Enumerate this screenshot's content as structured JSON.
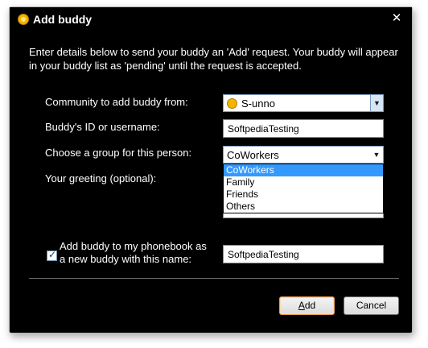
{
  "dialog": {
    "title": "Add buddy",
    "close_glyph": "✕",
    "intro": "Enter details below to send your buddy an 'Add' request. Your buddy will appear in your buddy list as 'pending' until the request is accepted."
  },
  "form": {
    "community_label": "Community to add buddy from:",
    "community_value": "S-unno",
    "buddy_id_label": "Buddy's ID or username:",
    "buddy_id_value": "SoftpediaTesting",
    "group_label": "Choose a group for this person:",
    "group_value": "CoWorkers",
    "group_options": [
      "CoWorkers",
      "Family",
      "Friends",
      "Others"
    ],
    "greeting_label": "Your greeting (optional):",
    "greeting_value": "",
    "phonebook_label_1": "Add buddy to my phonebook as",
    "phonebook_label_2": "a new buddy with this name:",
    "phonebook_checked": true,
    "phonebook_name_value": "SoftpediaTesting"
  },
  "buttons": {
    "add_underline": "A",
    "add_rest": "dd",
    "cancel": "Cancel"
  },
  "colors": {
    "background": "#000000",
    "highlight": "#3399ff",
    "default_button_border": "#e89a4a",
    "icon": "#f4b400"
  },
  "icons": {
    "title": "sunno-logo-icon",
    "community": "sunno-logo-icon",
    "dropdown": "chevron-down-icon",
    "close": "close-icon",
    "checkbox": "checkmark-icon"
  }
}
